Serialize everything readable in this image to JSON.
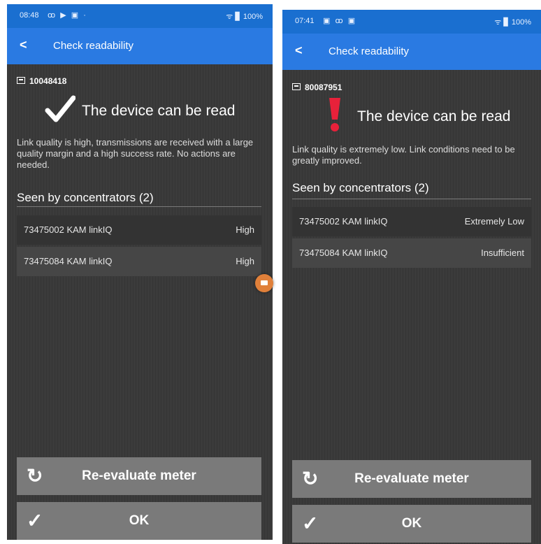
{
  "left": {
    "status_time": "08:48",
    "status_notifications": "ꝏ ▶ ▣ ·",
    "status_system": "ᯤ ▊ 100%",
    "app_title": "Check readability",
    "back_glyph": "<",
    "device_id": "10048418",
    "status_icon": "check-icon",
    "headline": "The device can be read",
    "description": "Link quality is high, transmissions are received with a large quality margin and a high success rate. No actions are needed.",
    "section_title": "Seen by concentrators (2)",
    "concentrators": [
      {
        "id": "73475002 KAM linkIQ",
        "quality": "High"
      },
      {
        "id": "73475084 KAM linkIQ",
        "quality": "High"
      }
    ],
    "reevaluate_label": "Re-evaluate meter",
    "ok_label": "OK"
  },
  "right": {
    "status_time": "07:41",
    "status_notifications": "▣ ꝏ ▣",
    "status_system": "ᯤ ▊ 100%",
    "app_title": "Check readability",
    "back_glyph": "<",
    "device_id": "80087951",
    "status_icon": "exclamation-icon",
    "headline": "The device can be read",
    "description": "Link quality is extremely low. Link conditions need to be greatly improved.",
    "section_title": "Seen by concentrators (2)",
    "concentrators": [
      {
        "id": "73475002 KAM linkIQ",
        "quality": "Extremely Low"
      },
      {
        "id": "73475084 KAM linkIQ",
        "quality": "Insufficient"
      }
    ],
    "reevaluate_label": "Re-evaluate meter",
    "ok_label": "OK"
  },
  "colors": {
    "app_bar": "#2a7ae2",
    "status_bar": "#1a6fd0",
    "background": "#3b3b3b",
    "button": "#7a7a7a",
    "warning": "#e8213a",
    "check": "#ffffff",
    "floating_badge": "#e0803a"
  }
}
